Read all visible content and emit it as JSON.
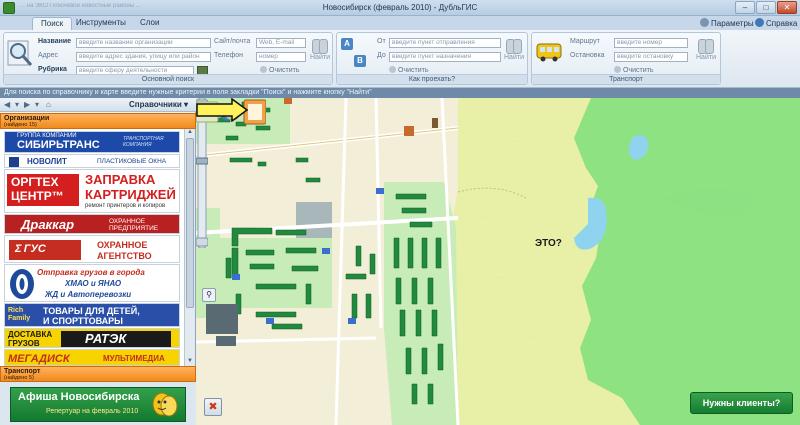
{
  "window": {
    "title": "Новосибирск (февраль 2010) - ДубльГИС",
    "quick_access_text": "... на ЭКСП ключевой новостные районы ...",
    "minimize": "–",
    "maximize": "□",
    "close": "✕"
  },
  "tabs": [
    {
      "label": "Поиск",
      "active": true
    },
    {
      "label": "Инструменты",
      "active": false
    },
    {
      "label": "Слои",
      "active": false
    }
  ],
  "top_links": {
    "params": "Параметры",
    "help": "Справка"
  },
  "ribbon": {
    "main_search": {
      "title": "Основной поиск",
      "fields": {
        "name": {
          "label": "Название",
          "placeholder": "введите название организации"
        },
        "address": {
          "label": "Адрес",
          "placeholder": "введите адрес здания, улицу или район"
        },
        "rubric": {
          "label": "Рубрика",
          "placeholder": "введите сферу деятельности"
        },
        "site": {
          "label": "Сайт/почта",
          "placeholder": "Web, E-mail"
        },
        "phone": {
          "label": "Телефон",
          "placeholder": "номер"
        }
      },
      "find": "Найти",
      "clear": "Очистить"
    },
    "route": {
      "title": "Как проехать?",
      "from": {
        "label": "От",
        "placeholder": "введите пункт отправления"
      },
      "to": {
        "label": "До",
        "placeholder": "введите пункт назначения"
      },
      "find": "Найти",
      "clear": "Очистить"
    },
    "transport": {
      "title": "Транспорт",
      "route_field": {
        "label": "Маршрут",
        "placeholder": "введите номер"
      },
      "stop_field": {
        "label": "Остановка",
        "placeholder": "введите остановку"
      },
      "find": "Найти",
      "clear": "Очистить"
    }
  },
  "hint": "Для поиска по справочнику и карте введите нужные критерии в поля закладки \"Поиск\" и нажмите кнопку \"Найти\"",
  "panel": {
    "directory_label": "Справочники ▾",
    "organizations": {
      "title": "Организации",
      "count": "(найдено 15)"
    },
    "transport": {
      "title": "Транспорт",
      "count": "(найдено 5)"
    },
    "ads": [
      {
        "name": "ad-sibirtrans",
        "line1": "ГРУППА КОМПАНИЙ",
        "line2": "СИБИРЬТРАНС",
        "line3": "ТРАНСПОРТНАЯ КОМПАНИЯ"
      },
      {
        "name": "ad-novolit",
        "line1": "НОВОЛИТ",
        "line2": "ПЛАСТИКОВЫЕ ОКНА"
      },
      {
        "name": "ad-orgtech",
        "line1": "ОРГТЕХ",
        "line2": "ЦЕНТР™",
        "line3": "ЗАПРАВКА",
        "line4": "КАРТРИДЖЕЙ",
        "line5": "ремонт принтеров и копиров"
      },
      {
        "name": "ad-drakkar",
        "line1": "Драккар",
        "line2": "ОХРАННОЕ ПРЕДПРИЯТИЕ"
      },
      {
        "name": "ad-argus",
        "line1": "Σ ГУС",
        "line2": "ОХРАННОЕ",
        "line3": "АГЕНТСТВО"
      },
      {
        "name": "ad-cargo",
        "line1": "Отправка грузов в города",
        "line2": "ХМАО и ЯНАО",
        "line3": "ЖД и Автоперевозки"
      },
      {
        "name": "ad-richfamily",
        "line1": "Rich Family",
        "line2": "ТОВАРЫ ДЛЯ ДЕТЕЙ,",
        "line3": "И СПОРТТОВАРЫ"
      },
      {
        "name": "ad-ratek",
        "line1": "ДОСТАВКА",
        "line2": "ГРУЗОВ",
        "line3": "РАТЭК"
      },
      {
        "name": "ad-megadisk",
        "line1": "МЕГАДИСК",
        "line2": "МУЛЬТИМЕДИА"
      }
    ],
    "afisha": {
      "title": "Афиша Новосибирска",
      "subtitle": "Репертуар на февраль 2010"
    }
  },
  "map": {
    "callout": "ЭТО?",
    "clients_button": "Нужны клиенты?",
    "colors": {
      "forest": "#8ee282",
      "field": "#e8efa6",
      "water": "#8fd3ef",
      "city": "#f3eed8",
      "building": "#218a3e"
    }
  }
}
